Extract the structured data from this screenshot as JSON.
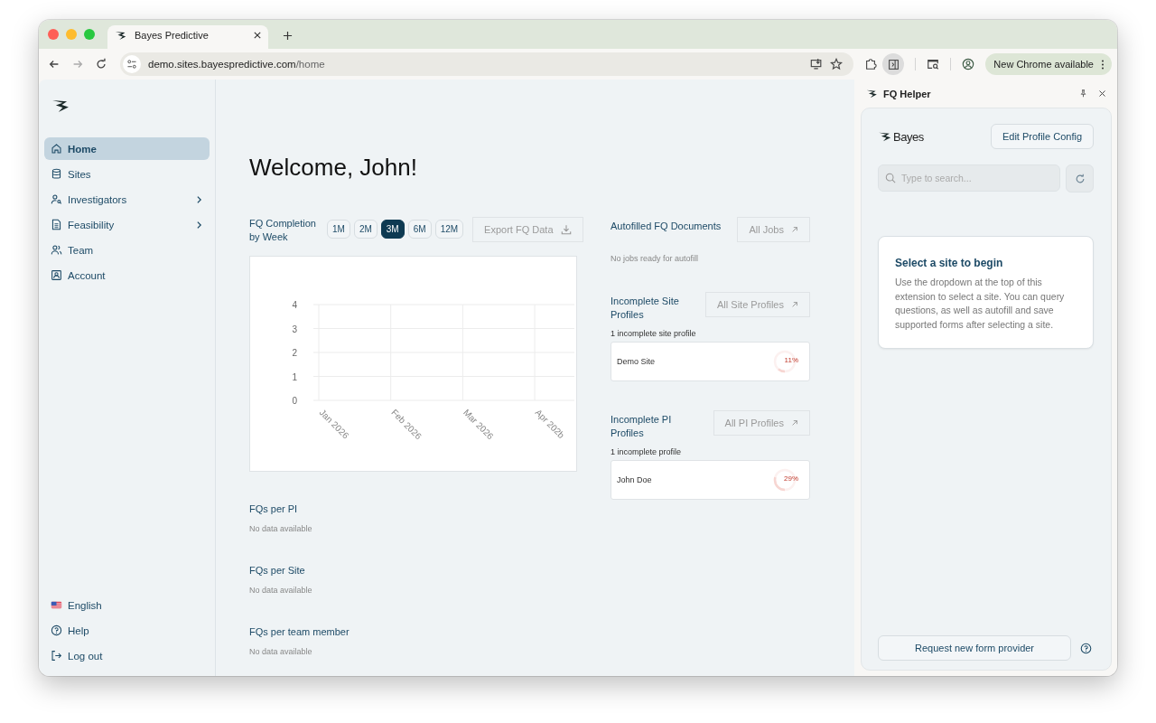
{
  "browser": {
    "tab": {
      "title": "Bayes Predictive"
    },
    "url": {
      "host": "demo.sites.bayespredictive.com",
      "path": "/home"
    },
    "side_panel_active": true,
    "update_button": "New Chrome available"
  },
  "sidebar": {
    "items": [
      {
        "label": "Home",
        "selected": true,
        "expandable": false
      },
      {
        "label": "Sites",
        "selected": false,
        "expandable": false
      },
      {
        "label": "Investigators",
        "selected": false,
        "expandable": true
      },
      {
        "label": "Feasibility",
        "selected": false,
        "expandable": true
      },
      {
        "label": "Team",
        "selected": false,
        "expandable": false
      },
      {
        "label": "Account",
        "selected": false,
        "expandable": false
      }
    ],
    "footer": [
      {
        "kind": "language",
        "label": "English"
      },
      {
        "kind": "help",
        "label": "Help"
      },
      {
        "kind": "logout",
        "label": "Log out"
      }
    ]
  },
  "main": {
    "greeting": "Welcome, John!",
    "completion": {
      "title": "FQ Completion by Week",
      "ranges": [
        {
          "label": "1M",
          "selected": false
        },
        {
          "label": "2M",
          "selected": false
        },
        {
          "label": "3M",
          "selected": true
        },
        {
          "label": "6M",
          "selected": false
        },
        {
          "label": "12M",
          "selected": false
        }
      ],
      "export_button": "Export FQ Data",
      "chart_data": {
        "type": "line",
        "categories": [
          "Jan 2026",
          "Feb 2026",
          "Mar 2026",
          "Apr 202b"
        ],
        "ylim": [
          0,
          4
        ],
        "grid": true,
        "yticks": [
          0,
          1,
          2,
          3,
          4
        ]
      }
    },
    "stats": [
      {
        "title": "FQs per PI",
        "message": "No data available"
      },
      {
        "title": "FQs per Site",
        "message": "No data available"
      },
      {
        "title": "FQs per team member",
        "message": "No data available"
      }
    ],
    "autofill": {
      "title": "Autofilled FQ Documents",
      "button": "All Jobs",
      "message": "No jobs ready for autofill"
    },
    "profiles": [
      {
        "title": "Incomplete Site Profiles",
        "button": "All Site Profiles",
        "count": "1 incomplete site profile",
        "items": [
          {
            "name": "Demo Site",
            "percent": "11%",
            "level": 0.11
          }
        ]
      },
      {
        "title": "Incomplete PI Profiles",
        "button": "All PI Profiles",
        "count": "1 incomplete profile",
        "items": [
          {
            "name": "John Doe",
            "percent": "29%",
            "level": 0.29
          }
        ]
      }
    ]
  },
  "helper": {
    "title": "FQ Helper",
    "logo": "Bayes",
    "edit_button": "Edit Profile Config",
    "search": {
      "placeholder": "Type to search..."
    },
    "info": {
      "title": "Select a site to begin",
      "text": "Use the dropdown at the top of this extension to select a site. You can query questions, as well as autofill and save supported forms after selecting a site."
    },
    "request_button": "Request new form provider"
  }
}
